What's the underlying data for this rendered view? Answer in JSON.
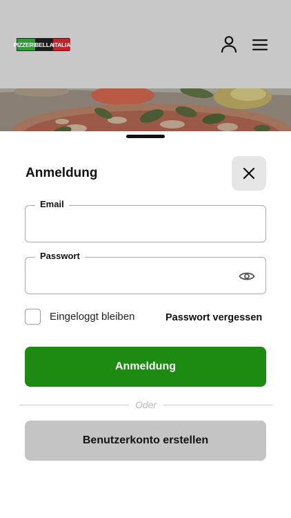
{
  "header": {
    "logo": {
      "part1": "PIZZERIA",
      "part2": "BELLA",
      "part3": "ITALIA"
    },
    "user_icon": "user-icon",
    "menu_icon": "hamburger-menu-icon",
    "background_color": "#c8c8c8"
  },
  "login": {
    "title": "Anmeldung",
    "close_icon": "close-icon",
    "email": {
      "label": "Email",
      "value": "",
      "placeholder": ""
    },
    "password": {
      "label": "Passwort",
      "value": "",
      "placeholder": "",
      "toggle_icon": "eye-icon"
    },
    "remember_me": {
      "label": "Eingeloggt bleiben",
      "checked": false
    },
    "forgot_password_label": "Passwort vergessen",
    "submit_label": "Anmeldung",
    "divider_text": "Oder",
    "create_account_label": "Benutzerkonto erstellen"
  },
  "colors": {
    "primary_green": "#1d8a12",
    "secondary_gray": "#c4c4c4",
    "close_bg": "#e6e6e6"
  }
}
